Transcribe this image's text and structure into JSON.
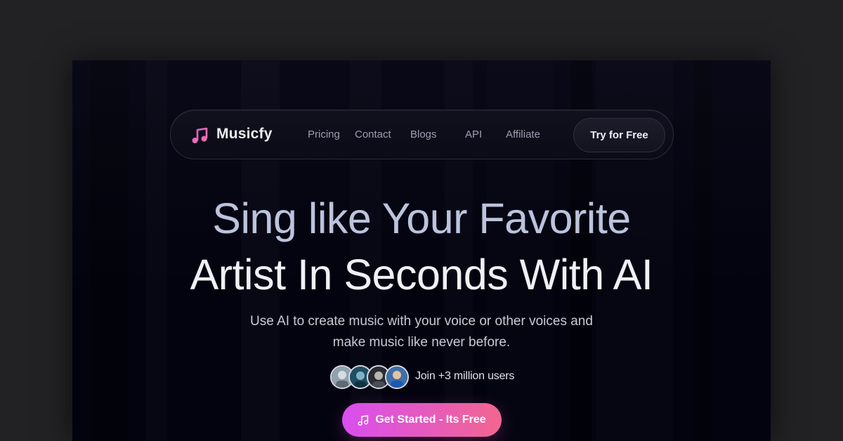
{
  "brand": {
    "name": "Musicfy",
    "icon": "music-note-icon",
    "accent_from": "#d94ef0",
    "accent_to": "#f2668f"
  },
  "nav": {
    "links": [
      "Pricing",
      "Contact",
      "Blogs",
      "API",
      "Affiliate"
    ],
    "cta_label": "Try for Free"
  },
  "hero": {
    "headline_line1": "Sing like Your Favorite",
    "headline_line2": "Artist In Seconds With AI",
    "subtitle_line1": "Use AI to create music with your voice or other voices and",
    "subtitle_line2": "make music like never before.",
    "social_proof": "Join +3 million users",
    "cta_label": "Get Started - Its Free",
    "cta_icon": "music-note-icon"
  },
  "colors": {
    "page_bg": "#03030f",
    "outer_bg": "#222225"
  }
}
